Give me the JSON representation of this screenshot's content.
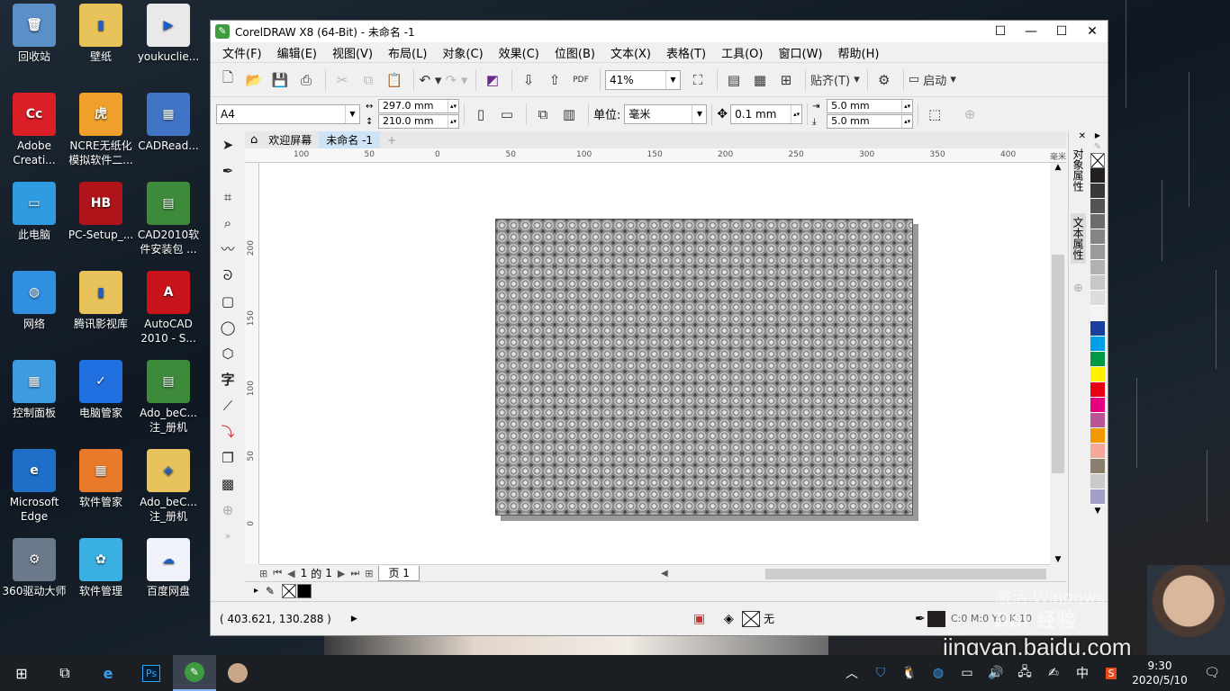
{
  "desktop": {
    "icons": [
      {
        "label": "回收站",
        "color": "#5b8fc7",
        "glyph": "🗑"
      },
      {
        "label": "壁纸",
        "color": "#e8c25a",
        "glyph": "▮"
      },
      {
        "label": "youkuclie...",
        "color": "#e9e9e9",
        "glyph": "▶"
      },
      {
        "label": "Adobe Creati...",
        "color": "#da1f26",
        "glyph": "Cc"
      },
      {
        "label": "NCRE无纸化模拟软件二...",
        "color": "#f0a02a",
        "glyph": "虎"
      },
      {
        "label": "CADRead...",
        "color": "#3f75c4",
        "glyph": "▦"
      },
      {
        "label": "此电脑",
        "color": "#2f9be0",
        "glyph": "▭"
      },
      {
        "label": "PC-Setup_...",
        "color": "#b0141a",
        "glyph": "HB"
      },
      {
        "label": "CAD2010软件安装包 ...",
        "color": "#3d8a3a",
        "glyph": "▤"
      },
      {
        "label": "网络",
        "color": "#2f8fe0",
        "glyph": "◍"
      },
      {
        "label": "腾讯影视库",
        "color": "#e8c25a",
        "glyph": "▮"
      },
      {
        "label": "AutoCAD 2010 - S...",
        "color": "#c8141a",
        "glyph": "A"
      },
      {
        "label": "控制面板",
        "color": "#3d9be0",
        "glyph": "▦"
      },
      {
        "label": "电脑管家",
        "color": "#1f6fe0",
        "glyph": "✓"
      },
      {
        "label": "Ado_beC... 注_册机",
        "color": "#3d8a3a",
        "glyph": "▤"
      },
      {
        "label": "Microsoft Edge",
        "color": "#1f6fc8",
        "glyph": "e"
      },
      {
        "label": "软件管家",
        "color": "#e87a2a",
        "glyph": "▦"
      },
      {
        "label": "Ado_beC... 注_册机",
        "color": "#e8c25a",
        "glyph": "◈"
      },
      {
        "label": "360驱动大师",
        "color": "#6a7a8a",
        "glyph": "⚙"
      },
      {
        "label": "软件管理",
        "color": "#3ab0e0",
        "glyph": "✿"
      },
      {
        "label": "百度网盘",
        "color": "#f0f4fa",
        "glyph": "☁"
      }
    ]
  },
  "window": {
    "title": "CorelDRAW X8 (64-Bit) - 未命名 -1",
    "menu": [
      "文件(F)",
      "编辑(E)",
      "视图(V)",
      "布局(L)",
      "对象(C)",
      "效果(C)",
      "位图(B)",
      "文本(X)",
      "表格(T)",
      "工具(O)",
      "窗口(W)",
      "帮助(H)"
    ],
    "toolbar": {
      "zoom": "41%",
      "snap_label": "贴齐(T)",
      "launch_label": "启动"
    },
    "propbar": {
      "page_size": "A4",
      "width": "297.0 mm",
      "height": "210.0 mm",
      "unit_label": "单位:",
      "unit_value": "毫米",
      "nudge": "0.1 mm",
      "dup_x": "5.0 mm",
      "dup_y": "5.0 mm"
    },
    "doc_tabs": {
      "welcome": "欢迎屏幕",
      "current": "未命名 -1"
    },
    "ruler_h": [
      "100",
      "50",
      "0",
      "50",
      "100",
      "150",
      "200",
      "250",
      "300",
      "350",
      "400"
    ],
    "ruler_h_unit": "毫米",
    "ruler_v": [
      "200",
      "150",
      "100",
      "50",
      "0"
    ],
    "page_nav": {
      "current": "1",
      "of_label": "的",
      "total": "1",
      "page_tab": "页 1"
    },
    "status": {
      "coords": "( 403.621, 130.288 )",
      "fill_none": "无",
      "outline_info": "C:0 M:0 Y:0 K:10"
    },
    "dockers": {
      "object_props": "对象属性",
      "text_props": "文本属性"
    },
    "palette": [
      "#ffffff",
      "#231f20",
      "#3b3838",
      "#555354",
      "#6d6b6c",
      "#858384",
      "#9b999a",
      "#b2b0b1",
      "#c8c6c7",
      "#dedcdd",
      "#f5f3f4",
      "#1a3f9c",
      "#00a0e9",
      "#009944",
      "#fff100",
      "#e60012",
      "#e4007f",
      "#b85594",
      "#f39800",
      "#f5a89a",
      "#8a7e6d",
      "#c9caca",
      "#a0a0c8"
    ]
  },
  "taskbar": {
    "time": "9:30",
    "date": "2020/5/10",
    "ime": "中"
  },
  "overlay": {
    "activate_text": "激活 Windows",
    "watermark": "jingyan.baidu.com",
    "watermark_brand": "Bai 经验"
  }
}
